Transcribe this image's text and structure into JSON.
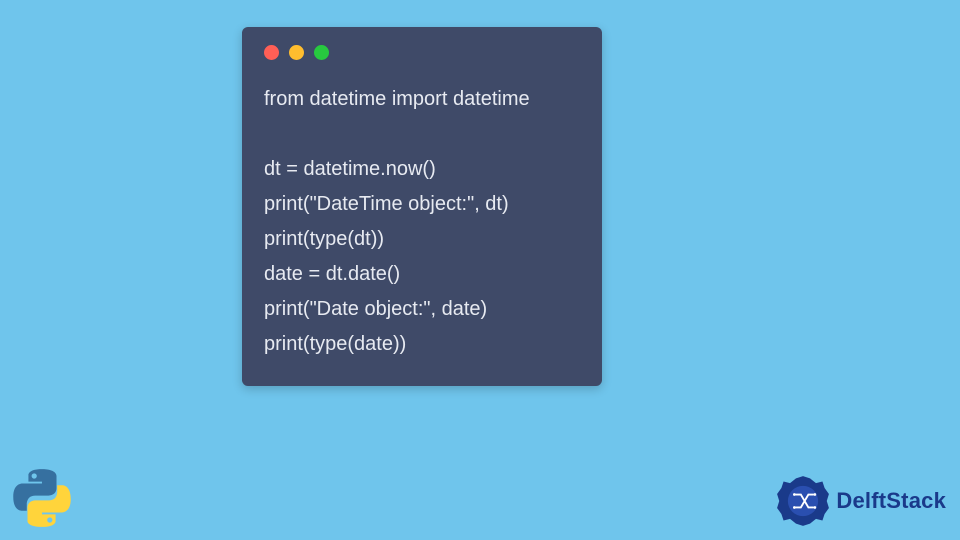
{
  "code": {
    "lines": [
      "from datetime import datetime",
      "",
      "dt = datetime.now()",
      "print(\"DateTime object:\", dt)",
      "print(type(dt))",
      "date = dt.date()",
      "print(\"Date object:\", date)",
      "print(type(date))"
    ]
  },
  "brand": {
    "name": "DelftStack"
  },
  "colors": {
    "background": "#6fc5ec",
    "card": "#3f4a68",
    "code_text": "#e7eaf1",
    "brand_text": "#1a3a8a",
    "dot_red": "#ff5f56",
    "dot_yellow": "#ffbd2e",
    "dot_green": "#27c93f"
  }
}
